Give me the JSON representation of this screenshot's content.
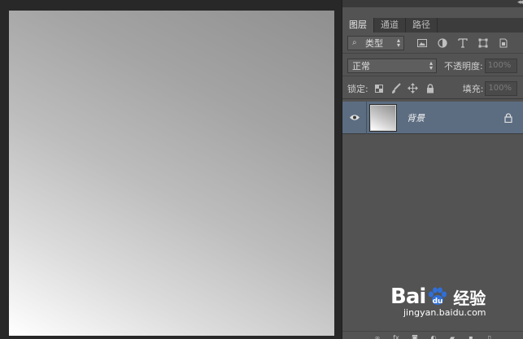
{
  "tabs": [
    {
      "label": "图层",
      "active": true
    },
    {
      "label": "通道",
      "active": false
    },
    {
      "label": "路径",
      "active": false
    }
  ],
  "filter": {
    "kind_label": "类型",
    "icons": [
      "image-filter-icon",
      "adjustment-filter-icon",
      "type-filter-icon",
      "shape-filter-icon",
      "smart-object-filter-icon"
    ]
  },
  "blend": {
    "mode": "正常",
    "opacity_label": "不透明度:",
    "opacity_value": "100%"
  },
  "lock": {
    "label": "锁定:",
    "fill_label": "填充:",
    "fill_value": "100%"
  },
  "layers": [
    {
      "name": "背景",
      "visible": true,
      "locked": true
    }
  ],
  "watermark": {
    "logo_a": "Bai",
    "logo_b": "经验",
    "url": "jingyan.baidu.com"
  },
  "colors": {
    "panel": "#535353",
    "selected_layer": "#5c6d82",
    "workspace": "#282828"
  }
}
